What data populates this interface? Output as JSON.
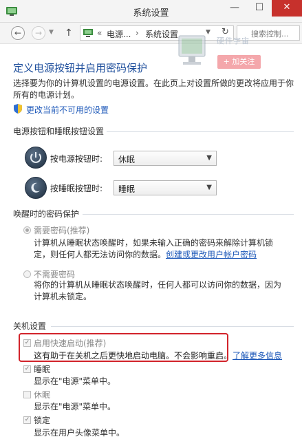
{
  "window": {
    "title": "系统设置",
    "minimize": "—",
    "maximize": "☐",
    "close": "✕"
  },
  "nav": {
    "back": "←",
    "forward": "→",
    "up": "↑",
    "breadcrumb": [
      "电源...",
      "系统设置"
    ],
    "bc_prefix": "«",
    "bc_sep": "›",
    "search_placeholder": "搜索控制..."
  },
  "overlay": {
    "watermark": "硬件宇宙",
    "follow_button": "+ 加关注"
  },
  "page": {
    "title": "定义电源按钮并启用密码保护",
    "description": "选择要为你的计算机设置的电源设置。在此页上对设置所做的更改将应用于你所有的电源计划。",
    "change_link": "更改当前不可用的设置"
  },
  "section_power": {
    "header": "电源按钮和睡眠按钮设置",
    "power_label": "按电源按钮时:",
    "power_value": "休眠",
    "sleep_label": "按睡眠按钮时:",
    "sleep_value": "睡眠"
  },
  "section_password": {
    "header": "唤醒时的密码保护",
    "opt1_label": "需要密码(推荐)",
    "opt1_desc": "计算机从睡眠状态唤醒时，如果未输入正确的密码来解除计算机锁定，则任何人都无法访问你的数据。",
    "opt1_link": "创建或更改用户帐户密码",
    "opt2_label": "不需要密码",
    "opt2_desc": "将你的计算机从睡眠状态唤醒时，任何人都可以访问你的数据，因为计算机未锁定。"
  },
  "section_shutdown": {
    "header": "关机设置",
    "fast_label": "启用快速启动(推荐)",
    "fast_desc": "这有助于在关机之后更快地启动电脑。不会影响重启。",
    "learn_link": "了解更多信息",
    "sleep_label": "睡眠",
    "sleep_desc": "显示在\"电源\"菜单中。",
    "hibernate_label": "休眠",
    "hibernate_desc": "显示在\"电源\"菜单中。",
    "lock_label": "锁定",
    "lock_desc": "显示在用户头像菜单中。"
  },
  "colors": {
    "link": "#1a56b8",
    "title": "#1c4d9b",
    "highlight": "#d2232a",
    "close": "#c7312c"
  }
}
